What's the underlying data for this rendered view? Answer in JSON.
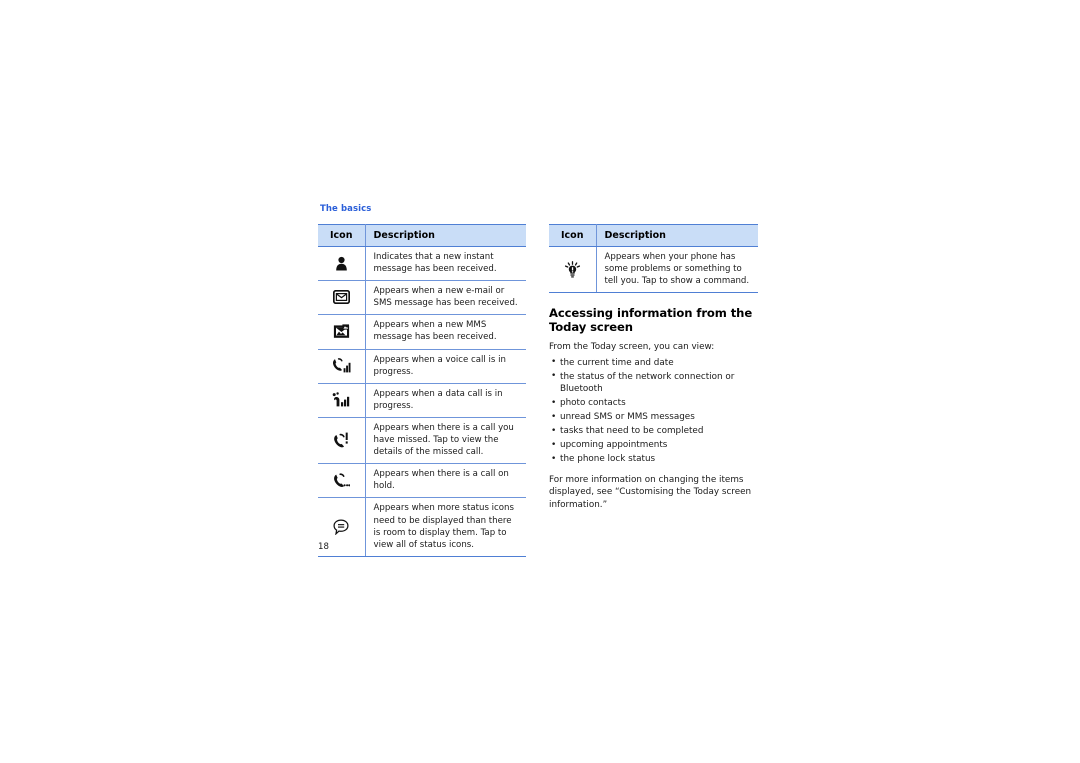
{
  "running_head": "The basics",
  "folio": "18",
  "theme": {
    "accent_blue": "#2b5fd9",
    "rule_blue": "#4f7fd4",
    "header_fill": "#c9ddf7",
    "text": "#1a1a1a"
  },
  "left_table": {
    "headers": {
      "icon": "Icon",
      "description": "Description"
    },
    "rows": [
      {
        "icon_name": "instant-message-icon",
        "description": "Indicates that a new instant message has been received."
      },
      {
        "icon_name": "email-sms-envelope-icon",
        "description": "Appears when a new e-mail or SMS message has been received."
      },
      {
        "icon_name": "mms-message-icon",
        "description": "Appears when a new MMS message has been received."
      },
      {
        "icon_name": "voice-call-in-progress-icon",
        "description": "Appears when a voice call is in progress."
      },
      {
        "icon_name": "data-call-in-progress-icon",
        "description": "Appears when a data call is in progress."
      },
      {
        "icon_name": "missed-call-icon",
        "description": "Appears when there is a call you have missed. Tap to view the details of the missed call."
      },
      {
        "icon_name": "call-on-hold-icon",
        "description": "Appears when there is a call on hold."
      },
      {
        "icon_name": "more-status-icons-icon",
        "description": "Appears when more status icons need to be displayed than there is room to display them. Tap to view all of status icons."
      }
    ]
  },
  "right_table": {
    "headers": {
      "icon": "Icon",
      "description": "Description"
    },
    "rows": [
      {
        "icon_name": "notification-bulb-icon",
        "description": "Appears when your phone has some problems or something to tell you. Tap to show a command."
      }
    ]
  },
  "section": {
    "heading": "Accessing information from the Today screen",
    "intro": "From the Today screen, you can view:",
    "bullets": [
      "the current time and date",
      "the status of the network connection or Bluetooth",
      "photo contacts",
      "unread SMS or MMS messages",
      "tasks that need to be completed",
      "upcoming appointments",
      "the phone lock status"
    ],
    "outro": "For more information on changing the items displayed, see “Customising the Today screen information.”"
  }
}
